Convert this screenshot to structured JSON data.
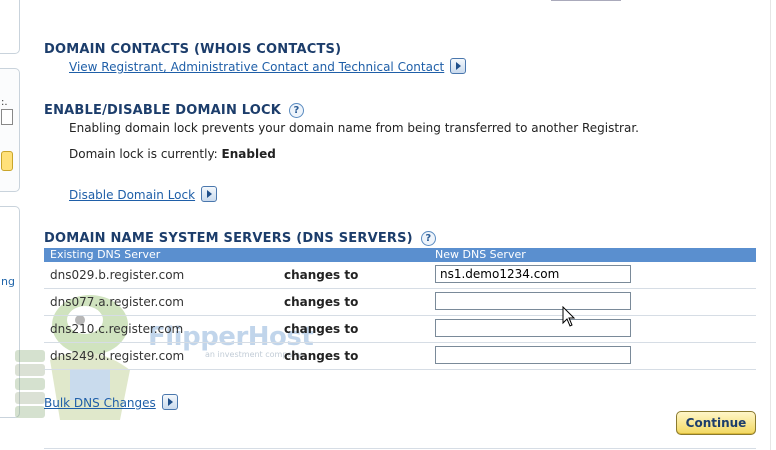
{
  "sidebar": {
    "fragment_colon": ":.",
    "fragment_link": "ng"
  },
  "contacts": {
    "title": "DOMAIN CONTACTS (WHOIS CONTACTS)",
    "link": "View Registrant, Administrative Contact and Technical Contact"
  },
  "lock": {
    "title": "ENABLE/DISABLE DOMAIN LOCK",
    "description": "Enabling domain lock prevents your domain name from being transferred to another Registrar.",
    "status_label": "Domain lock is currently:",
    "status_value": "Enabled",
    "toggle_link": "Disable Domain Lock"
  },
  "dns": {
    "title": "DOMAIN NAME SYSTEM SERVERS (DNS SERVERS)",
    "col_existing": "Existing DNS Server",
    "col_new": "New DNS Server",
    "changes_label": "changes to",
    "rows": [
      {
        "existing": "dns029.b.register.com",
        "new": "ns1.demo1234.com"
      },
      {
        "existing": "dns077.a.register.com",
        "new": ""
      },
      {
        "existing": "dns210.c.register.com",
        "new": ""
      },
      {
        "existing": "dns249.d.register.com",
        "new": ""
      }
    ],
    "bulk_link": "Bulk DNS Changes"
  },
  "actions": {
    "continue_label": "Continue"
  },
  "watermark": {
    "brand": "FlipperHost",
    "tagline": "an investment company"
  },
  "icons": {
    "help": "help-icon",
    "arrow": "arrow-right-icon"
  }
}
